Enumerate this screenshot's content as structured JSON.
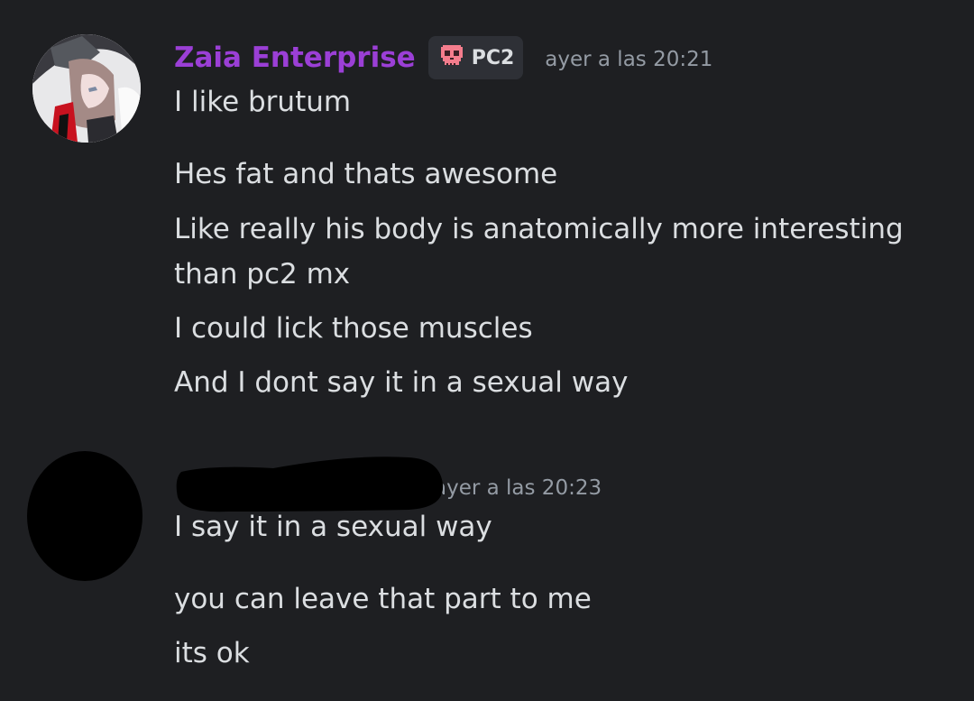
{
  "messages": [
    {
      "username": "Zaia Enterprise",
      "tag": {
        "icon": "skull-icon",
        "label": "PC2",
        "icon_color": "#f47d8d"
      },
      "timestamp": "ayer a las 20:21",
      "lines": [
        "I like brutum",
        "Hes fat and thats awesome",
        "Like really his body is anatomically more interesting than pc2 mx",
        "I could lick those muscles",
        "And I dont say it in a sexual way"
      ]
    },
    {
      "username_redacted": true,
      "timestamp": "ayer a las 20:23",
      "lines": [
        "I say it in a sexual way",
        "you can leave that part to me",
        "its ok"
      ]
    }
  ],
  "colors": {
    "background": "#1e1f22",
    "username": "#9b3fd6",
    "text": "#dbdee1",
    "timestamp": "#949ba4"
  }
}
